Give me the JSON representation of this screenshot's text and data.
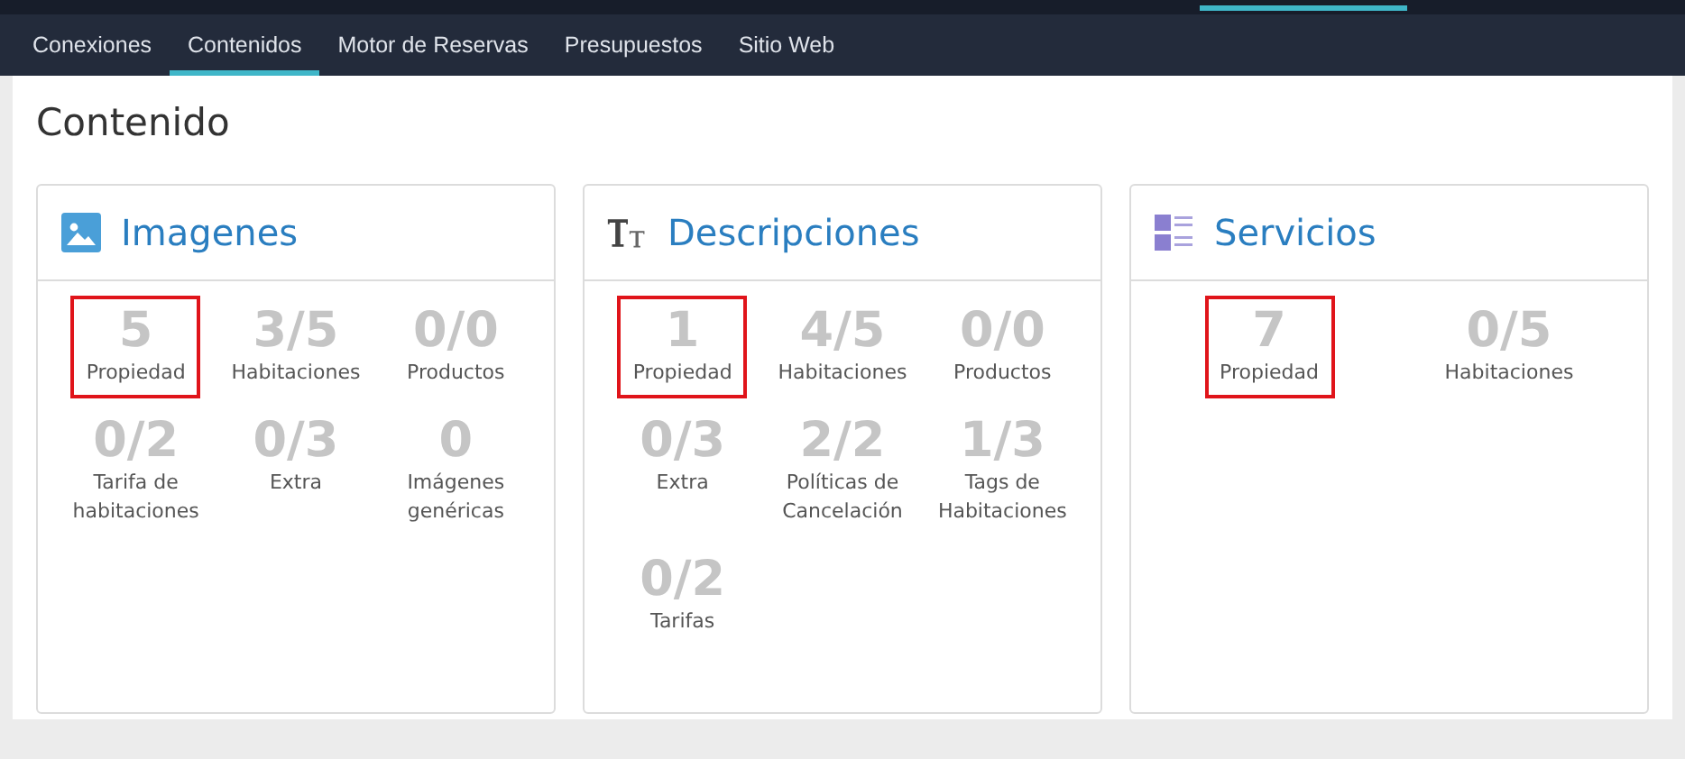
{
  "nav": {
    "tabs": [
      {
        "label": "Conexiones",
        "selected": false
      },
      {
        "label": "Contenidos",
        "selected": true
      },
      {
        "label": "Motor de Reservas",
        "selected": false
      },
      {
        "label": "Presupuestos",
        "selected": false
      },
      {
        "label": "Sitio Web",
        "selected": false
      }
    ]
  },
  "page": {
    "title": "Contenido"
  },
  "cards": [
    {
      "kind": "images",
      "title": "Imagenes",
      "stats": [
        {
          "value": "5",
          "label": "Propiedad",
          "highlighted": true
        },
        {
          "value": "3/5",
          "label": "Habitaciones",
          "highlighted": false
        },
        {
          "value": "0/0",
          "label": "Productos",
          "highlighted": false
        },
        {
          "value": "0/2",
          "label": "Tarifa de habitaciones",
          "highlighted": false
        },
        {
          "value": "0/3",
          "label": "Extra",
          "highlighted": false
        },
        {
          "value": "0",
          "label": "Imágenes genéricas",
          "highlighted": false
        }
      ]
    },
    {
      "kind": "descriptions",
      "title": "Descripciones",
      "stats": [
        {
          "value": "1",
          "label": "Propiedad",
          "highlighted": true
        },
        {
          "value": "4/5",
          "label": "Habitaciones",
          "highlighted": false
        },
        {
          "value": "0/0",
          "label": "Productos",
          "highlighted": false
        },
        {
          "value": "0/3",
          "label": "Extra",
          "highlighted": false
        },
        {
          "value": "2/2",
          "label": "Políticas de Cancelación",
          "highlighted": false
        },
        {
          "value": "1/3",
          "label": "Tags de Habitaciones",
          "highlighted": false
        },
        {
          "value": "0/2",
          "label": "Tarifas",
          "highlighted": false
        }
      ]
    },
    {
      "kind": "services",
      "title": "Servicios",
      "stats": [
        {
          "value": "7",
          "label": "Propiedad",
          "highlighted": true
        },
        {
          "value": "0/5",
          "label": "Habitaciones",
          "highlighted": false
        }
      ]
    }
  ]
}
